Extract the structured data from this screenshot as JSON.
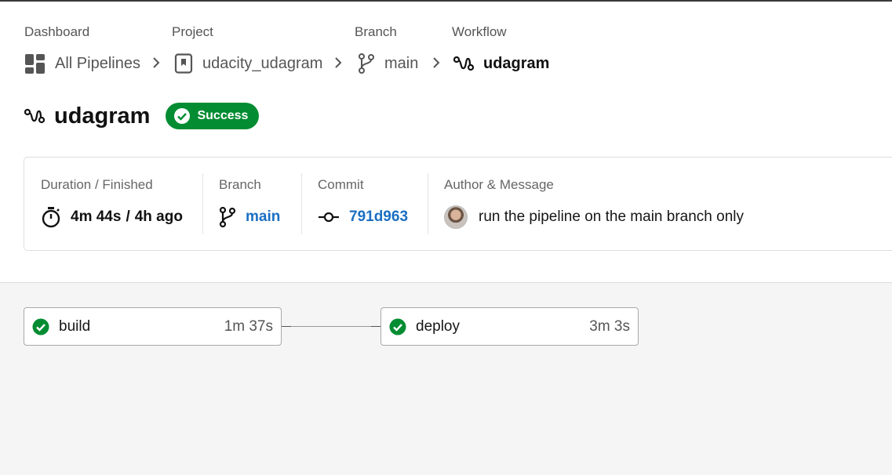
{
  "breadcrumb": {
    "dashboard": {
      "label": "Dashboard",
      "value": "All Pipelines",
      "icon": "dashboard-grid-icon"
    },
    "project": {
      "label": "Project",
      "value": "udacity_udagram",
      "icon": "project-bookmark-icon"
    },
    "branch": {
      "label": "Branch",
      "value": "main",
      "icon": "git-branch-icon"
    },
    "workflow": {
      "label": "Workflow",
      "value": "udagram",
      "icon": "workflow-icon"
    }
  },
  "header": {
    "title": "udagram",
    "status": "Success",
    "status_color": "#038c32"
  },
  "info": {
    "duration": {
      "label": "Duration / Finished",
      "duration": "4m 44s",
      "separator": "/",
      "finished": "4h ago",
      "icon": "stopwatch-icon"
    },
    "branch": {
      "label": "Branch",
      "value": "main",
      "icon": "git-branch-icon"
    },
    "commit": {
      "label": "Commit",
      "value": "791d963",
      "icon": "git-commit-icon"
    },
    "author": {
      "label": "Author & Message",
      "message": "run the pipeline on the main branch only",
      "icon": "avatar"
    }
  },
  "jobs": [
    {
      "name": "build",
      "duration": "1m 37s",
      "status": "success"
    },
    {
      "name": "deploy",
      "duration": "3m 3s",
      "status": "success"
    }
  ],
  "colors": {
    "link": "#1a6fc2",
    "success": "#038c32"
  }
}
